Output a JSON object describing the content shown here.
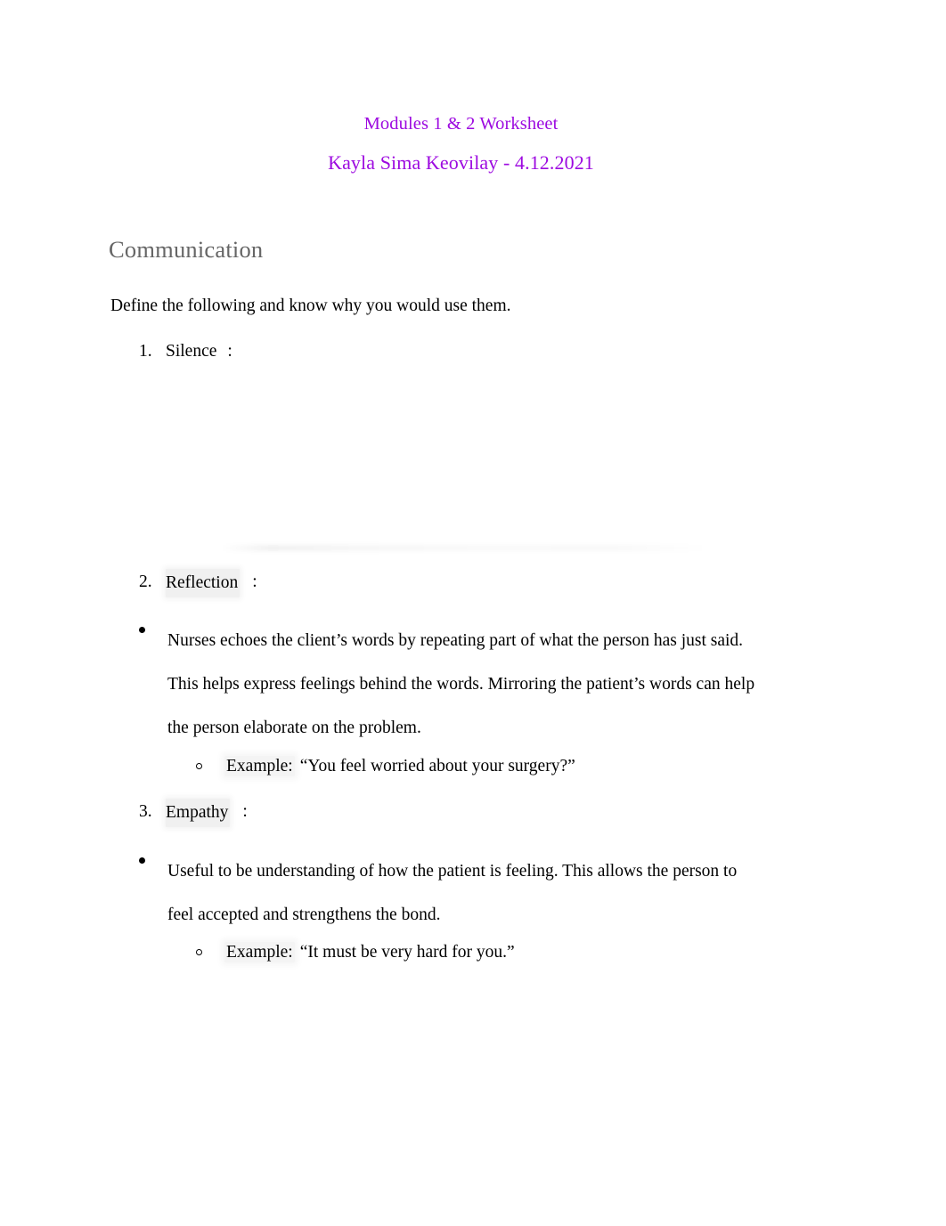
{
  "document": {
    "title": "Modules 1 & 2 Worksheet",
    "subtitle": "Kayla Sima Keovilay - 4.12.2021",
    "title_color": "#9d0ae0",
    "heading_color": "#666666",
    "body_color": "#000000",
    "page_background": "#ffffff"
  },
  "section": {
    "heading": "Communication",
    "intro": "Define the following and know why you would use them."
  },
  "items": [
    {
      "number": "1.",
      "term": "Silence",
      "separator": ":",
      "content": []
    },
    {
      "number": "2.",
      "term": "Reflection",
      "separator": ":",
      "content": [
        {
          "type": "bullet",
          "text": "Nurses echoes the client’s words by repeating part of what the person has just said. This helps express feelings behind the words. Mirroring the patient’s words can help the person elaborate on the problem."
        },
        {
          "type": "sub-bullet",
          "label": "Example:",
          "text": "“You feel worried about your surgery?”"
        }
      ]
    },
    {
      "number": "3.",
      "term": "Empathy",
      "separator": ":",
      "content": [
        {
          "type": "bullet",
          "text": "Useful to be understanding of how the patient is feeling. This allows the person to feel accepted and strengthens the bond."
        },
        {
          "type": "sub-bullet",
          "label": "Example:",
          "text": "“It must be very hard for you.”"
        }
      ]
    }
  ]
}
